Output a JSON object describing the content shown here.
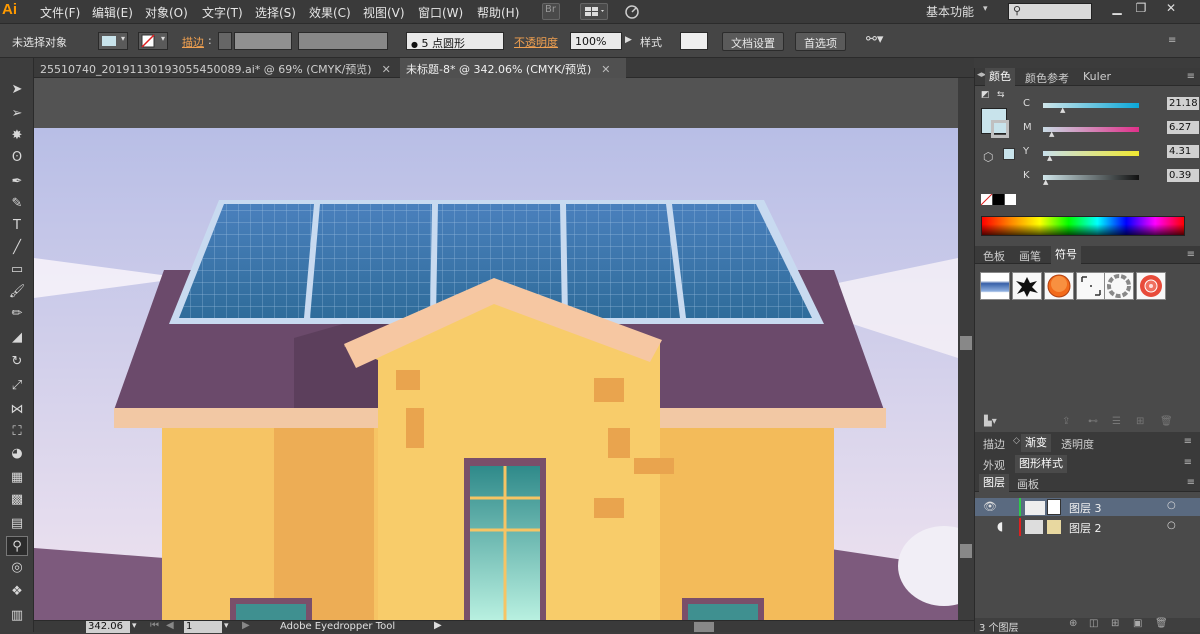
{
  "app": {
    "logo": "Ai"
  },
  "menu": [
    "文件(F)",
    "编辑(E)",
    "对象(O)",
    "文字(T)",
    "选择(S)",
    "效果(C)",
    "视图(V)",
    "窗口(W)",
    "帮助(H)"
  ],
  "menubar": {
    "bridge": "Br",
    "workspace": "基本功能",
    "search_placeholder": ""
  },
  "control": {
    "selection": "未选择对象",
    "stroke_label": "描边",
    "brush": "5 点圆形",
    "opacity_label": "不透明度",
    "opacity_value": "100%",
    "style_label": "样式",
    "doc_setup": "文档设置",
    "preferences": "首选项"
  },
  "tabs": [
    {
      "label": "25510740_20191130193055450089.ai* @ 69% (CMYK/预览)",
      "active": false
    },
    {
      "label": "未标题-8* @ 342.06% (CMYK/预览)",
      "active": true
    }
  ],
  "color_panel": {
    "tabs": [
      "颜色",
      "颜色参考",
      "Kuler"
    ],
    "sliders": [
      {
        "label": "C",
        "value": "21.18"
      },
      {
        "label": "M",
        "value": "6.27"
      },
      {
        "label": "Y",
        "value": "4.31"
      },
      {
        "label": "K",
        "value": "0.39"
      }
    ],
    "fill_color": "#c8e3eb"
  },
  "swatch_panel": {
    "tabs": [
      "色板",
      "画笔",
      "符号"
    ]
  },
  "stroke_panel": {
    "tabs": [
      "描边",
      "渐变",
      "透明度"
    ]
  },
  "appearance_panel": {
    "tabs": [
      "外观",
      "图形样式"
    ]
  },
  "layers_panel": {
    "tabs": [
      "图层",
      "画板"
    ],
    "layers": [
      {
        "name": "图层 3",
        "selected": true
      },
      {
        "name": "图层 2",
        "selected": false
      }
    ],
    "count": "3 个图层"
  },
  "status": {
    "zoom": "342.06",
    "page": "1",
    "tool": "Adobe Eyedropper Tool"
  }
}
